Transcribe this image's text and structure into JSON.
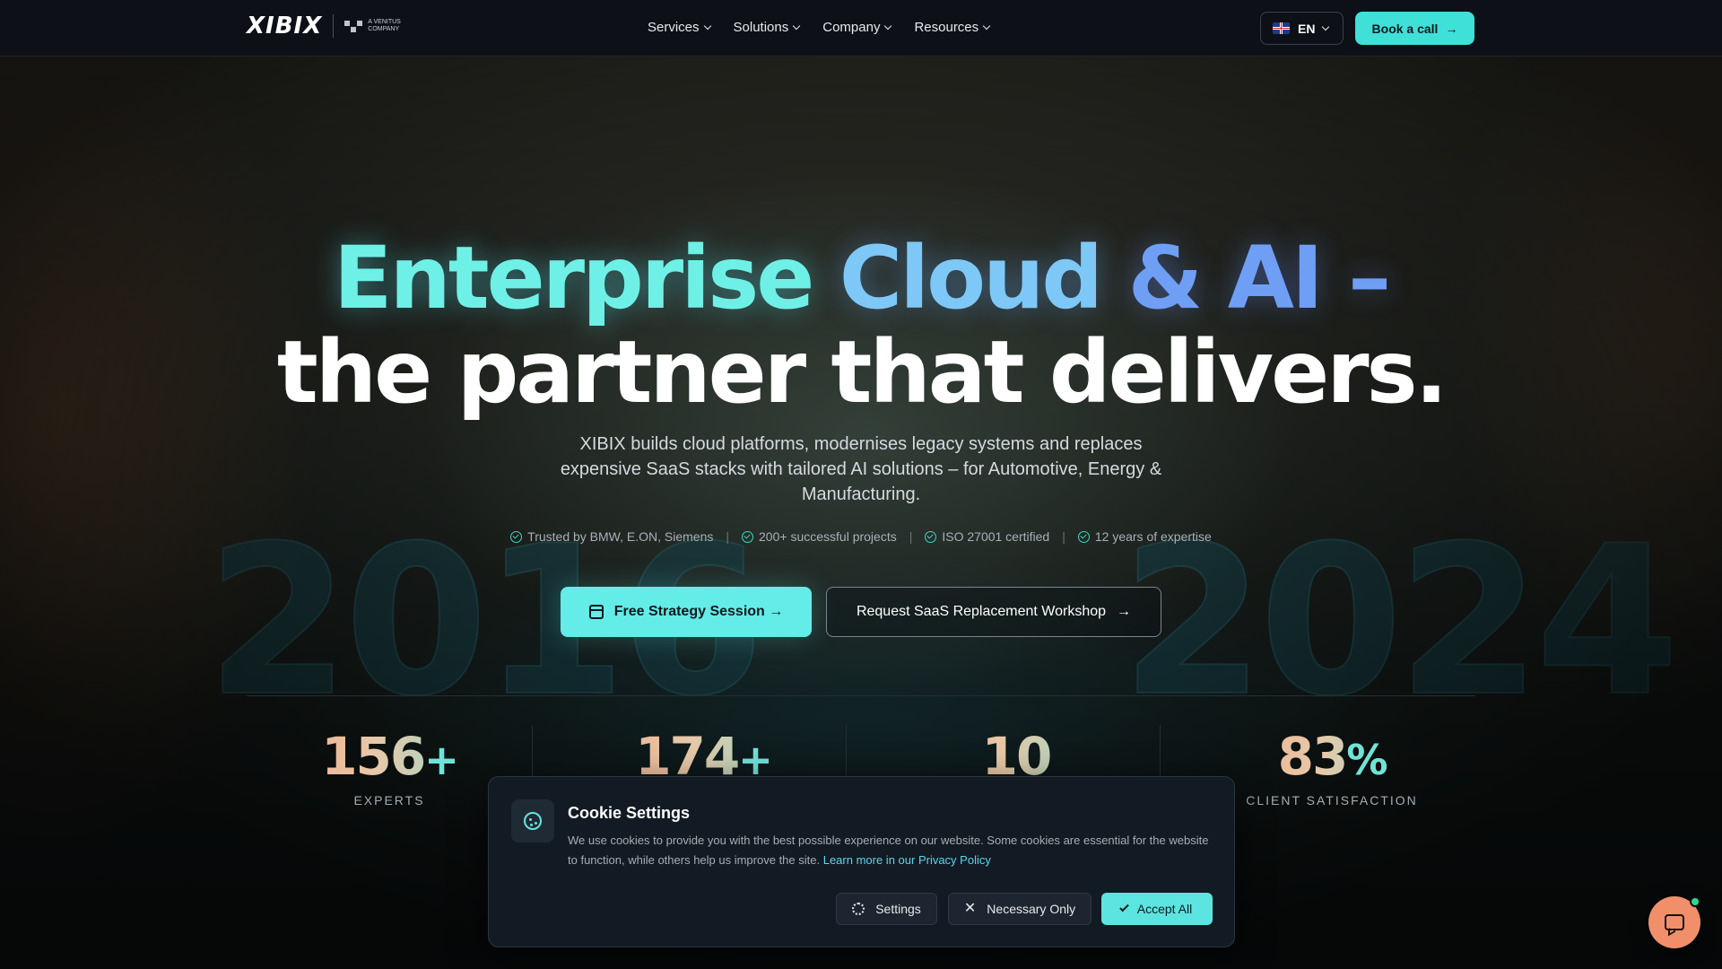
{
  "header": {
    "logo_text": "XIBIX",
    "logo_sub": "A VENITUS COMPANY",
    "nav": [
      {
        "label": "Services"
      },
      {
        "label": "Solutions"
      },
      {
        "label": "Company"
      },
      {
        "label": "Resources"
      }
    ],
    "language": "EN",
    "book_label": "Book a call"
  },
  "hero": {
    "title_part1": "Enterprise",
    "title_part2": "Cloud",
    "title_part3": "& AI –",
    "title_line2": "the partner that delivers.",
    "subtitle": "XIBIX builds cloud platforms, modernises legacy systems and replaces expensive SaaS stacks with tailored AI solutions – for Automotive, Energy & Manufacturing.",
    "trust": [
      "Trusted by BMW, E.ON, Siemens",
      "200+ successful projects",
      "ISO 27001 certified",
      "12 years of expertise"
    ],
    "cta_primary": "Free Strategy Session →",
    "cta_secondary": "Request SaaS Replacement Workshop",
    "background_numbers": [
      "2016",
      "2024"
    ]
  },
  "stats": [
    {
      "value": "156",
      "suffix": "+",
      "label": "EXPERTS"
    },
    {
      "value": "174",
      "suffix": "+",
      "label": ""
    },
    {
      "value": "10",
      "suffix": "",
      "label": ""
    },
    {
      "value": "83",
      "suffix": "%",
      "label": "CLIENT SATISFACTION"
    }
  ],
  "cookie": {
    "title": "Cookie Settings",
    "text": "We use cookies to provide you with the best possible experience on our website. Some cookies are essential for the website to function, while others help us improve the site.",
    "link": "Learn more in our Privacy Policy",
    "settings_label": "Settings",
    "necessary_label": "Necessary Only",
    "accept_label": "Accept All"
  },
  "colors": {
    "accent": "#63ece8",
    "chat": "#f18f6b",
    "header_bg": "#0d1117"
  },
  "icons": {
    "chat": "chat-bubble-icon",
    "cookie": "cookie-icon",
    "calendar": "calendar-icon"
  }
}
